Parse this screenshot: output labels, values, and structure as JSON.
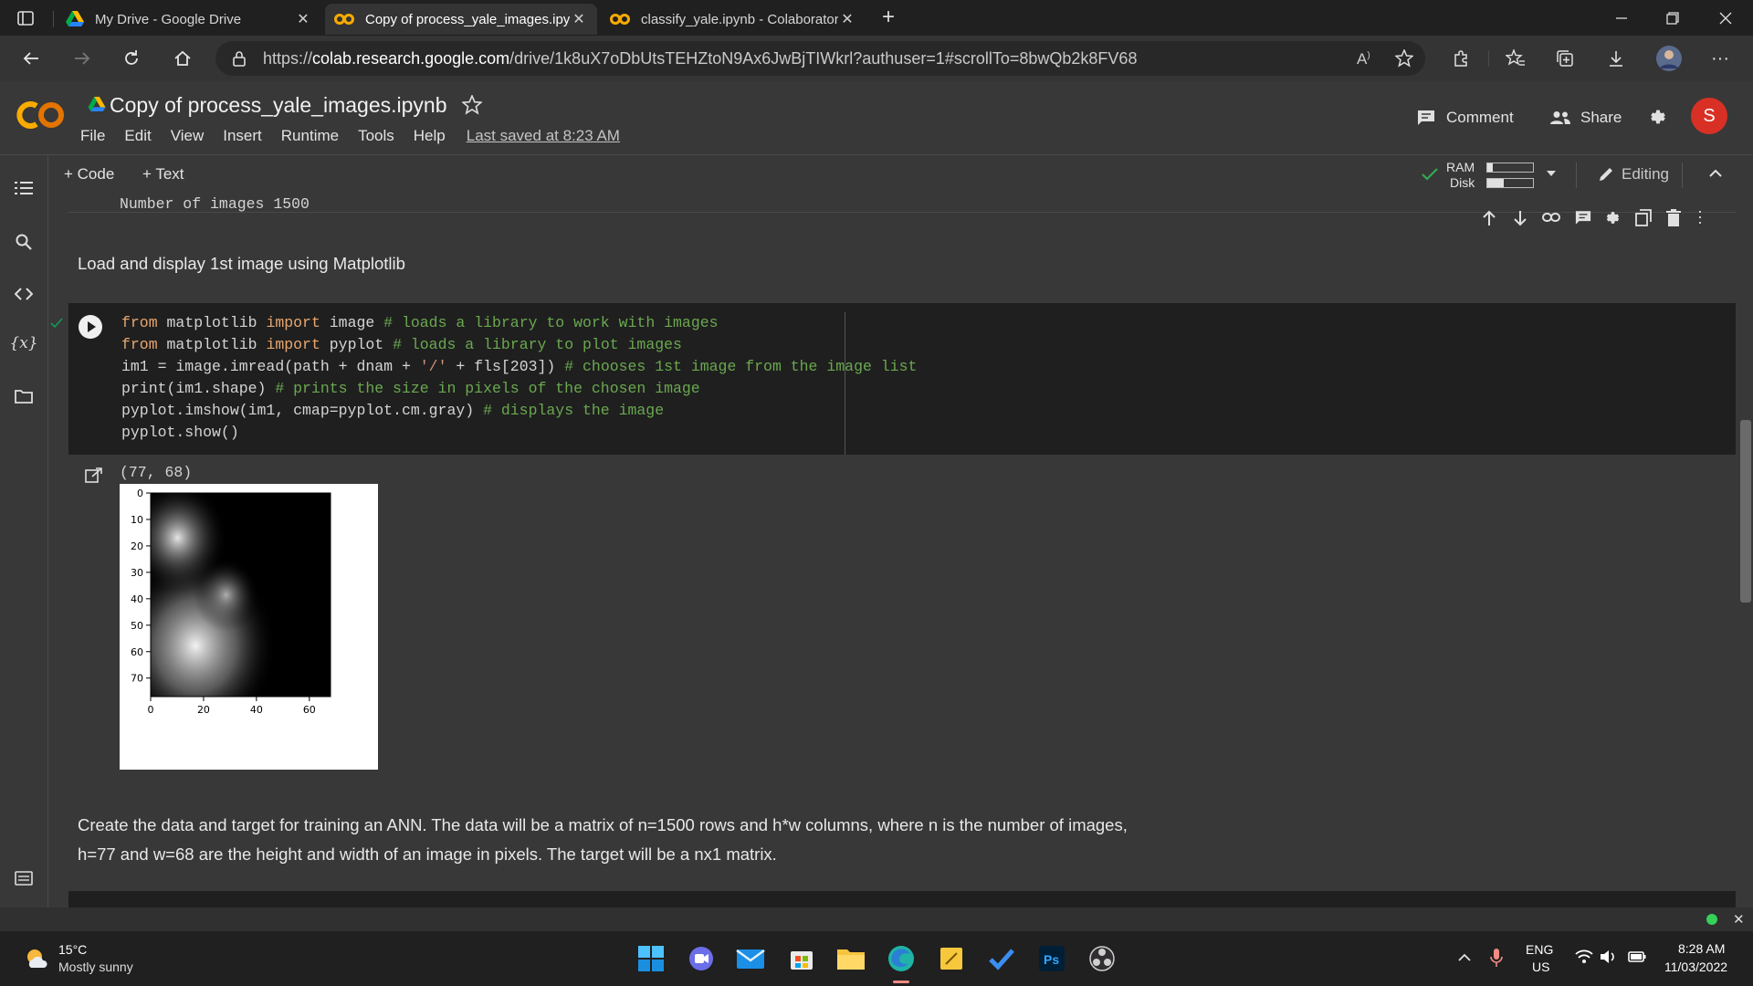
{
  "browser": {
    "tabs": [
      {
        "title": "My Drive - Google Drive",
        "active": false
      },
      {
        "title": "Copy of process_yale_images.ipy",
        "active": true
      },
      {
        "title": "classify_yale.ipynb - Colaborator",
        "active": false
      }
    ],
    "url_prefix": "https://",
    "url_host": "colab.research.google.com",
    "url_path": "/drive/1k8uX7oDbUtsTEHZtoN9Ax6JwBjTIWkrl?authuser=1#scrollTo=8bwQb2k8FV68"
  },
  "colab": {
    "logo_text": "CO",
    "title": "Copy of process_yale_images.ipynb",
    "menu": [
      "File",
      "Edit",
      "View",
      "Insert",
      "Runtime",
      "Tools",
      "Help"
    ],
    "last_saved": "Last saved at 8:23 AM",
    "comment_label": "Comment",
    "share_label": "Share",
    "avatar_letter": "S",
    "avatar_color": "#d93025",
    "add_code": "+ Code",
    "add_text": "+ Text",
    "ram_label": "RAM",
    "disk_label": "Disk",
    "editing_label": "Editing"
  },
  "notebook": {
    "prev_output": "Number of images 1500",
    "text1": "Load and display 1st image using Matplotlib",
    "code": {
      "l1_a": "from",
      "l1_b": " matplotlib ",
      "l1_c": "import",
      "l1_d": " image ",
      "l1_e": "# loads a library to work with images",
      "l2_a": "from",
      "l2_b": " matplotlib ",
      "l2_c": "import",
      "l2_d": " pyplot ",
      "l2_e": "# loads a library to plot images",
      "l3_a": "im1 = image.imread(path + dnam + ",
      "l3_b": "'/'",
      "l3_c": " + fls[203]) ",
      "l3_d": "# chooses 1st image from the image list",
      "l4_a": "print(im1.shape) ",
      "l4_b": "# prints the size in pixels of the chosen image",
      "l5_a": "pyplot.imshow(im1, cmap=pyplot.cm.gray) ",
      "l5_b": "# displays the image",
      "l6_a": "pyplot.show()"
    },
    "output_shape": "(77, 68)",
    "text2_line1": "Create the data and target for training an ANN. The data will be a matrix of n=1500 rows and h*w columns, where n is the number of images,",
    "text2_line2": "h=77 and w=68 are the height and width of an image in pixels. The target will be a nx1 matrix.",
    "cell_status_color": "#0f9d58"
  },
  "chart_data": {
    "type": "image",
    "x_ticks": [
      "0",
      "20",
      "40",
      "60"
    ],
    "y_ticks": [
      "0",
      "10",
      "20",
      "30",
      "40",
      "50",
      "60",
      "70"
    ],
    "xlim": [
      0,
      68
    ],
    "ylim": [
      77,
      0
    ]
  },
  "taskbar": {
    "weather_temp": "15°C",
    "weather_desc": "Mostly sunny",
    "lang": "ENG",
    "region": "US",
    "time": "8:28 AM",
    "date": "11/03/2022"
  }
}
